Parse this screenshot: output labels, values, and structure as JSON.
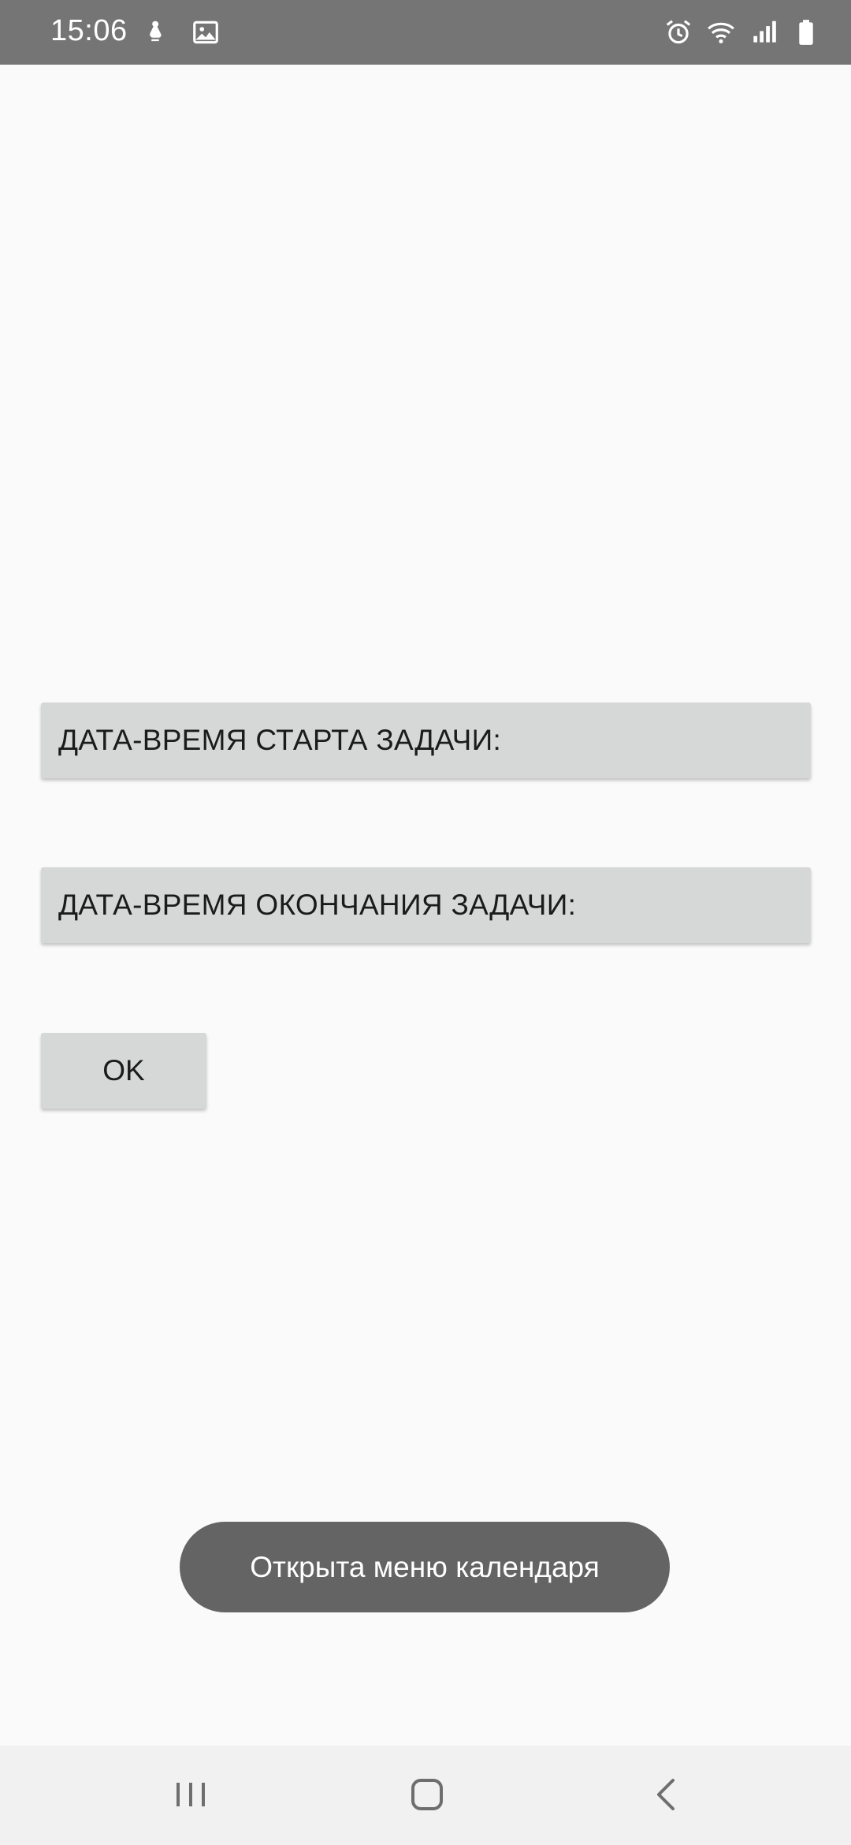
{
  "status_bar": {
    "time": "15:06",
    "left_icons": [
      "notification-icon",
      "gallery-icon"
    ],
    "right_icons": [
      "alarm-icon",
      "wifi-icon",
      "signal-icon",
      "battery-icon"
    ]
  },
  "form": {
    "start_label": "ДАТА-ВРЕМЯ СТАРТА ЗАДАЧИ:",
    "end_label": "ДАТА-ВРЕМЯ ОКОНЧАНИЯ ЗАДАЧИ:",
    "ok_label": "OK"
  },
  "toast": {
    "message": "Открыта меню календаря"
  },
  "nav_bar": {
    "buttons": [
      "recent-apps-icon",
      "home-icon",
      "back-icon"
    ]
  },
  "colors": {
    "status_bar": "#757575",
    "background": "#fafafa",
    "button": "#d6d7d7",
    "toast": "#646464",
    "nav_bar": "#f1f1f1"
  }
}
